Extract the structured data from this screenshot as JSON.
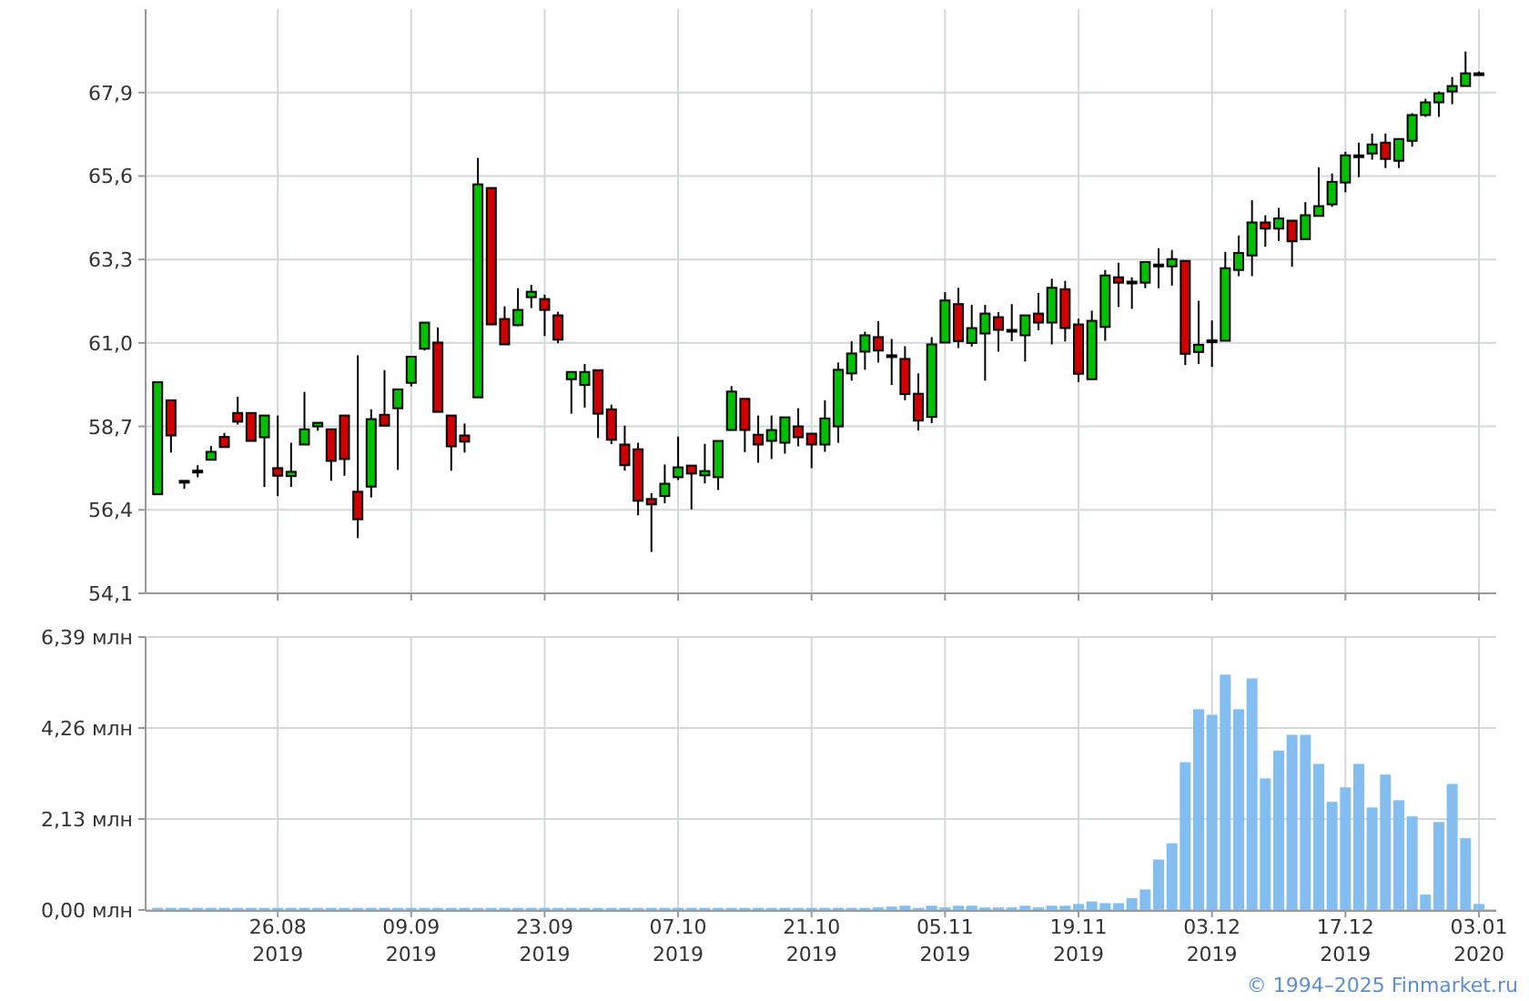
{
  "price_chart": {
    "chart_data": {
      "type": "candlestick",
      "grid": true,
      "ylim": [
        54.1,
        70.2
      ],
      "yticks": [
        {
          "value": 54.1,
          "label": "54,1"
        },
        {
          "value": 56.4,
          "label": "56,4"
        },
        {
          "value": 58.7,
          "label": "58,7"
        },
        {
          "value": 61.0,
          "label": "61,0"
        },
        {
          "value": 63.3,
          "label": "63,3"
        },
        {
          "value": 65.6,
          "label": "65,6"
        },
        {
          "value": 67.9,
          "label": "67,9"
        }
      ],
      "categories": [
        null,
        null,
        null,
        null,
        null,
        null,
        null,
        null,
        null,
        null,
        null,
        null,
        null,
        null,
        null,
        null,
        null,
        null,
        null,
        null,
        null,
        null,
        null,
        null,
        null,
        null,
        null,
        null,
        null,
        null,
        null,
        null,
        null,
        null,
        null,
        null,
        null,
        null,
        null,
        null,
        null,
        null,
        null,
        null,
        null,
        null,
        null,
        null,
        null,
        null,
        null,
        null,
        null,
        null,
        null,
        null,
        null,
        null,
        null,
        null,
        null,
        null,
        null,
        null,
        null,
        null,
        null,
        null,
        null,
        null,
        null,
        null,
        null,
        null,
        null,
        null,
        null,
        null,
        null,
        null,
        null,
        null,
        null,
        null,
        null,
        null,
        null,
        null,
        null,
        null,
        null,
        null,
        null,
        null,
        null,
        null,
        null,
        null,
        null,
        null
      ],
      "ohlc": [
        [
          56.83,
          59.92,
          56.83,
          59.92
        ],
        [
          59.42,
          59.42,
          57.98,
          58.45
        ],
        [
          57.2,
          57.2,
          56.98,
          57.15
        ],
        [
          57.48,
          57.63,
          57.3,
          57.48
        ],
        [
          57.78,
          58.16,
          57.78,
          58.0
        ],
        [
          58.41,
          58.52,
          58.13,
          58.13
        ],
        [
          59.07,
          59.52,
          58.75,
          58.83
        ],
        [
          59.07,
          59.07,
          58.3,
          58.3
        ],
        [
          58.4,
          59.0,
          57.03,
          59.0
        ],
        [
          57.55,
          59.0,
          56.78,
          57.34
        ],
        [
          57.33,
          58.25,
          57.03,
          57.45
        ],
        [
          58.2,
          59.65,
          58.2,
          58.62
        ],
        [
          58.7,
          58.8,
          58.58,
          58.8
        ],
        [
          58.62,
          58.62,
          57.2,
          57.75
        ],
        [
          59.0,
          59.0,
          57.34,
          57.8
        ],
        [
          56.9,
          60.66,
          55.62,
          56.14
        ],
        [
          57.04,
          59.17,
          56.74,
          58.9
        ],
        [
          59.02,
          60.25,
          58.72,
          58.72
        ],
        [
          59.2,
          59.72,
          57.5,
          59.72
        ],
        [
          59.9,
          60.62,
          59.8,
          60.62
        ],
        [
          60.84,
          61.56,
          60.79,
          61.56
        ],
        [
          61.01,
          61.43,
          59.1,
          59.1
        ],
        [
          59.0,
          59.0,
          57.48,
          58.15
        ],
        [
          58.45,
          58.78,
          57.98,
          58.28
        ],
        [
          59.5,
          66.1,
          59.5,
          65.37
        ],
        [
          65.27,
          65.27,
          61.51,
          61.51
        ],
        [
          61.66,
          62.01,
          60.96,
          60.96
        ],
        [
          61.49,
          62.51,
          61.46,
          61.91
        ],
        [
          62.26,
          62.6,
          61.96,
          62.41
        ],
        [
          62.21,
          62.33,
          61.19,
          61.91
        ],
        [
          61.76,
          61.86,
          60.99,
          61.09
        ],
        [
          60.0,
          60.2,
          59.05,
          60.2
        ],
        [
          59.84,
          60.42,
          59.22,
          60.2
        ],
        [
          60.25,
          60.25,
          58.38,
          59.05
        ],
        [
          59.17,
          59.3,
          58.21,
          58.33
        ],
        [
          58.2,
          58.72,
          57.48,
          57.63
        ],
        [
          58.07,
          58.25,
          56.25,
          56.65
        ],
        [
          56.7,
          56.86,
          55.24,
          56.55
        ],
        [
          56.78,
          57.65,
          56.58,
          57.12
        ],
        [
          57.3,
          58.42,
          57.22,
          57.57
        ],
        [
          57.62,
          57.62,
          56.41,
          57.4
        ],
        [
          57.35,
          58.22,
          57.13,
          57.47
        ],
        [
          57.3,
          58.3,
          56.95,
          58.3
        ],
        [
          58.6,
          59.81,
          58.6,
          59.66
        ],
        [
          59.46,
          59.46,
          57.99,
          58.6
        ],
        [
          58.47,
          59.0,
          57.7,
          58.2
        ],
        [
          58.3,
          59.0,
          57.8,
          58.6
        ],
        [
          58.25,
          58.95,
          57.95,
          58.95
        ],
        [
          58.7,
          59.2,
          58.15,
          58.4
        ],
        [
          58.5,
          58.5,
          57.55,
          58.2
        ],
        [
          58.2,
          59.42,
          58.0,
          58.92
        ],
        [
          58.7,
          60.46,
          58.25,
          60.26
        ],
        [
          60.16,
          61.05,
          59.96,
          60.71
        ],
        [
          60.76,
          61.31,
          60.26,
          61.21
        ],
        [
          61.16,
          61.6,
          60.46,
          60.79
        ],
        [
          60.66,
          61.11,
          59.84,
          60.61
        ],
        [
          60.56,
          60.91,
          59.42,
          59.59
        ],
        [
          59.6,
          60.16,
          58.59,
          58.86
        ],
        [
          58.96,
          61.16,
          58.79,
          60.96
        ],
        [
          61.01,
          62.4,
          61.01,
          62.17
        ],
        [
          62.07,
          62.52,
          60.86,
          61.05
        ],
        [
          61.0,
          62.05,
          60.9,
          61.41
        ],
        [
          61.26,
          62.05,
          59.96,
          61.81
        ],
        [
          61.71,
          61.85,
          60.76,
          61.36
        ],
        [
          61.36,
          62.07,
          61.05,
          61.36
        ],
        [
          61.21,
          61.76,
          60.49,
          61.76
        ],
        [
          61.81,
          62.38,
          61.35,
          61.56
        ],
        [
          61.56,
          62.77,
          60.96,
          62.52
        ],
        [
          62.48,
          62.71,
          61.04,
          61.41
        ],
        [
          61.51,
          61.67,
          59.92,
          60.15
        ],
        [
          60.0,
          61.89,
          60.0,
          61.61
        ],
        [
          61.44,
          63.01,
          61.06,
          62.86
        ],
        [
          62.81,
          63.21,
          61.99,
          62.66
        ],
        [
          62.69,
          62.81,
          61.94,
          62.69
        ],
        [
          62.66,
          63.23,
          62.51,
          63.23
        ],
        [
          63.16,
          63.61,
          62.51,
          63.16
        ],
        [
          63.11,
          63.56,
          62.58,
          63.31
        ],
        [
          63.26,
          63.26,
          60.39,
          60.7
        ],
        [
          60.75,
          62.16,
          60.42,
          60.95
        ],
        [
          61.07,
          61.62,
          60.34,
          61.07
        ],
        [
          61.06,
          63.51,
          61.06,
          63.06
        ],
        [
          63.01,
          63.96,
          62.84,
          63.48
        ],
        [
          63.41,
          64.93,
          62.84,
          64.32
        ],
        [
          64.32,
          64.52,
          63.65,
          64.15
        ],
        [
          64.15,
          64.72,
          63.81,
          64.43
        ],
        [
          64.37,
          64.37,
          63.1,
          63.8
        ],
        [
          63.86,
          64.88,
          63.86,
          64.52
        ],
        [
          64.5,
          65.84,
          64.5,
          64.77
        ],
        [
          64.82,
          65.67,
          64.75,
          65.44
        ],
        [
          65.42,
          66.27,
          65.15,
          66.17
        ],
        [
          66.17,
          66.52,
          65.57,
          66.17
        ],
        [
          66.22,
          66.77,
          66.05,
          66.47
        ],
        [
          66.52,
          66.77,
          65.82,
          66.07
        ],
        [
          66.02,
          66.62,
          65.82,
          66.62
        ],
        [
          66.57,
          67.33,
          66.41,
          67.28
        ],
        [
          67.28,
          67.73,
          67.23,
          67.63
        ],
        [
          67.63,
          67.93,
          67.23,
          67.88
        ],
        [
          67.93,
          68.33,
          67.58,
          68.08
        ],
        [
          68.08,
          69.03,
          68.08,
          68.43
        ],
        [
          68.43,
          68.48,
          68.38,
          68.43
        ]
      ]
    }
  },
  "volume_chart": {
    "chart_data": {
      "type": "bar",
      "grid": true,
      "ylim": [
        0,
        6.39
      ],
      "yticks": [
        {
          "value": 0,
          "label": "0,00 млн"
        },
        {
          "value": 2.13,
          "label": "2,13 млн"
        },
        {
          "value": 4.26,
          "label": "4,26 млн"
        },
        {
          "value": 6.39,
          "label": "6,39 млн"
        }
      ],
      "categories": [
        null,
        null,
        null,
        null,
        null,
        null,
        null,
        null,
        null,
        "26.08 2019",
        null,
        null,
        null,
        null,
        null,
        null,
        null,
        null,
        null,
        "09.09 2019",
        null,
        null,
        null,
        null,
        null,
        null,
        null,
        null,
        null,
        "23.09 2019",
        null,
        null,
        null,
        null,
        null,
        null,
        null,
        null,
        null,
        "07.10 2019",
        null,
        null,
        null,
        null,
        null,
        null,
        null,
        null,
        null,
        "21.10 2019",
        null,
        null,
        null,
        null,
        null,
        null,
        null,
        null,
        null,
        "05.11 2019",
        null,
        null,
        null,
        null,
        null,
        null,
        null,
        null,
        null,
        "19.11 2019",
        null,
        null,
        null,
        null,
        null,
        null,
        null,
        null,
        null,
        "03.12 2019",
        null,
        null,
        null,
        null,
        null,
        null,
        null,
        null,
        null,
        "17.12 2019",
        null,
        null,
        null,
        null,
        null,
        null,
        null,
        null,
        null,
        "03.01 2020"
      ],
      "series": [
        {
          "color": "#84bdf0",
          "values": [
            0.05,
            0.05,
            0.05,
            0.05,
            0.05,
            0.05,
            0.05,
            0.05,
            0.05,
            0.05,
            0.05,
            0.05,
            0.05,
            0.05,
            0.05,
            0.05,
            0.05,
            0.05,
            0.05,
            0.05,
            0.05,
            0.05,
            0.05,
            0.05,
            0.05,
            0.05,
            0.05,
            0.05,
            0.05,
            0.05,
            0.05,
            0.05,
            0.05,
            0.05,
            0.05,
            0.05,
            0.05,
            0.05,
            0.05,
            0.05,
            0.05,
            0.05,
            0.05,
            0.05,
            0.05,
            0.05,
            0.05,
            0.05,
            0.05,
            0.05,
            0.05,
            0.05,
            0.05,
            0.05,
            0.06,
            0.08,
            0.1,
            0.05,
            0.1,
            0.06,
            0.1,
            0.1,
            0.06,
            0.06,
            0.06,
            0.1,
            0.06,
            0.1,
            0.1,
            0.14,
            0.2,
            0.16,
            0.16,
            0.28,
            0.48,
            1.18,
            1.56,
            3.46,
            4.7,
            4.57,
            5.51,
            4.7,
            5.42,
            3.08,
            3.73,
            4.1,
            4.1,
            3.42,
            2.53,
            2.87,
            3.42,
            2.4,
            3.17,
            2.57,
            2.19,
            0.36,
            2.06,
            2.95,
            1.68,
            0.14
          ]
        }
      ]
    }
  },
  "copyright": "© 1994–2025 Finmarket.ru"
}
